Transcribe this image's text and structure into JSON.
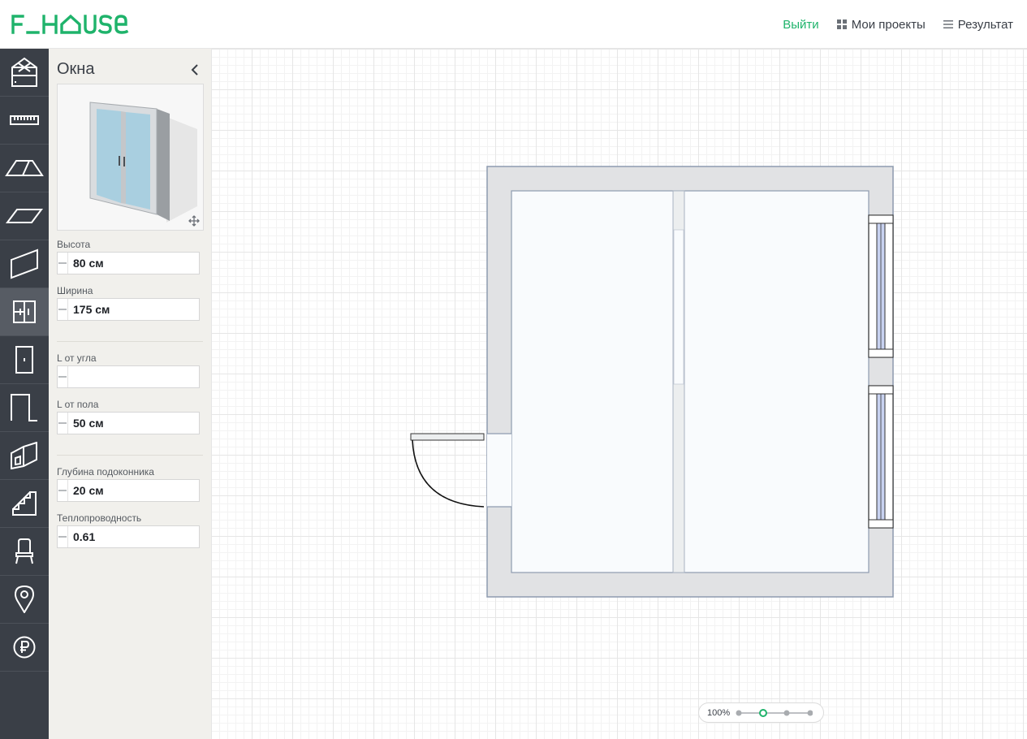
{
  "header": {
    "logo_text": "F_HOUSE",
    "nav": {
      "exit_label": "Выйти",
      "projects_label": "Мои проекты",
      "result_label": "Результат"
    }
  },
  "colors": {
    "brand": "#1fb36b",
    "toolbar_bg": "#3a3f47",
    "panel_bg": "#f1f0ec",
    "wall": "#e1e2e4",
    "wall_stroke": "#8e9bb0",
    "window_glass": "#c8d2f0"
  },
  "toolbar": {
    "tools": [
      {
        "name": "house-icon",
        "active": false
      },
      {
        "name": "ruler-icon",
        "active": false
      },
      {
        "name": "roof-icon",
        "active": false
      },
      {
        "name": "floor-icon",
        "active": false
      },
      {
        "name": "wall-icon",
        "active": false
      },
      {
        "name": "window-icon",
        "active": true
      },
      {
        "name": "door-icon",
        "active": false
      },
      {
        "name": "opening-icon",
        "active": false
      },
      {
        "name": "facade-icon",
        "active": false
      },
      {
        "name": "stairs-icon",
        "active": false
      },
      {
        "name": "chair-icon",
        "active": false
      },
      {
        "name": "location-icon",
        "active": false
      },
      {
        "name": "ruble-icon",
        "active": false
      }
    ]
  },
  "panel": {
    "title": "Окна",
    "fields": {
      "height": {
        "label": "Высота",
        "value": "80 см"
      },
      "width": {
        "label": "Ширина",
        "value": "175 см"
      },
      "from_corner": {
        "label": "L от угла",
        "value": ""
      },
      "from_floor": {
        "label": "L от пола",
        "value": "50 см"
      },
      "sill_depth": {
        "label": "Глубина подоконника",
        "value": "20 см"
      },
      "thermal": {
        "label": "Теплопроводность",
        "value": "0.61"
      }
    }
  },
  "zoom": {
    "label": "100%",
    "levels": 4,
    "active_index": 1
  }
}
